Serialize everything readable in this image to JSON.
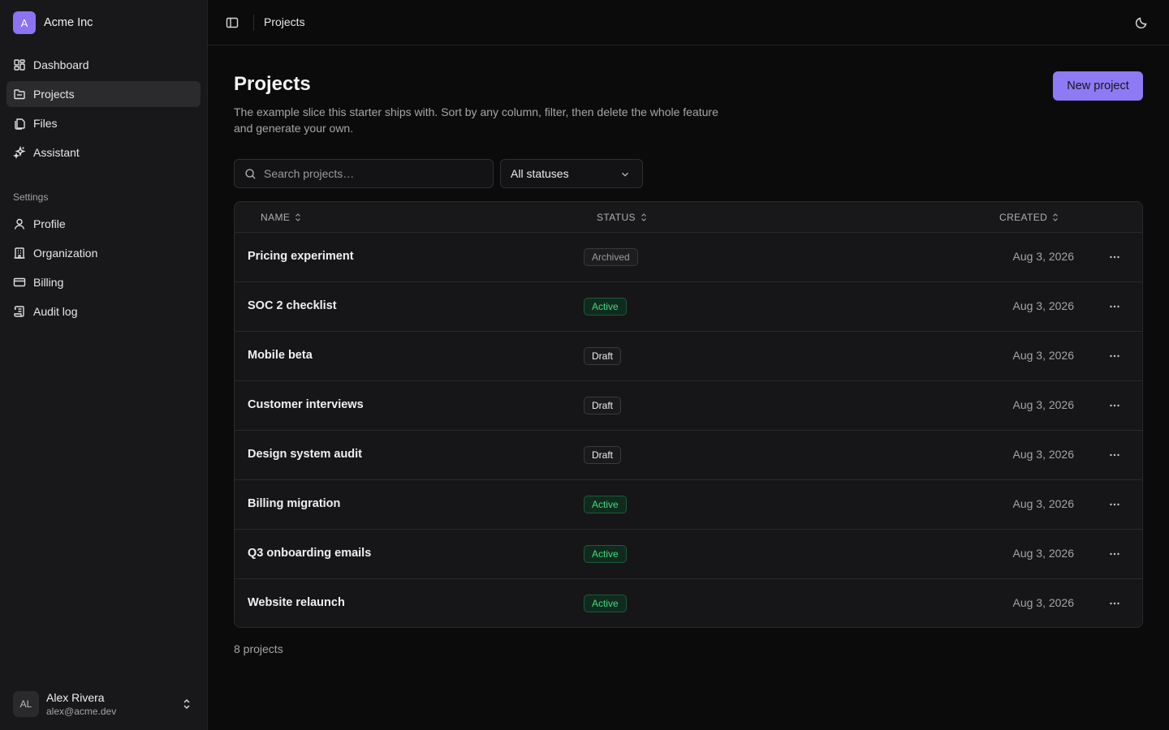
{
  "org": {
    "initial": "A",
    "name": "Acme Inc"
  },
  "nav": {
    "items": [
      {
        "label": "Dashboard",
        "icon": "dashboard-icon",
        "active": false
      },
      {
        "label": "Projects",
        "icon": "folder-icon",
        "active": true
      },
      {
        "label": "Files",
        "icon": "files-icon",
        "active": false
      },
      {
        "label": "Assistant",
        "icon": "sparkles-icon",
        "active": false
      }
    ],
    "settings_label": "Settings",
    "settings_items": [
      {
        "label": "Profile",
        "icon": "user-icon"
      },
      {
        "label": "Organization",
        "icon": "building-icon"
      },
      {
        "label": "Billing",
        "icon": "credit-card-icon"
      },
      {
        "label": "Audit log",
        "icon": "scroll-icon"
      }
    ]
  },
  "user": {
    "initials": "AL",
    "name": "Alex Rivera",
    "email": "alex@acme.dev"
  },
  "topbar": {
    "breadcrumb": "Projects"
  },
  "page": {
    "title": "Projects",
    "description": "The example slice this starter ships with. Sort by any column, filter, then delete the whole feature and generate your own.",
    "new_button": "New project"
  },
  "filters": {
    "search_placeholder": "Search projects…",
    "status_value": "All statuses"
  },
  "table": {
    "columns": [
      "NAME",
      "STATUS",
      "CREATED"
    ],
    "rows": [
      {
        "name": "Pricing experiment",
        "status": "Archived",
        "created": "Aug 3, 2026"
      },
      {
        "name": "SOC 2 checklist",
        "status": "Active",
        "created": "Aug 3, 2026"
      },
      {
        "name": "Mobile beta",
        "status": "Draft",
        "created": "Aug 3, 2026"
      },
      {
        "name": "Customer interviews",
        "status": "Draft",
        "created": "Aug 3, 2026"
      },
      {
        "name": "Design system audit",
        "status": "Draft",
        "created": "Aug 3, 2026"
      },
      {
        "name": "Billing migration",
        "status": "Active",
        "created": "Aug 3, 2026"
      },
      {
        "name": "Q3 onboarding emails",
        "status": "Active",
        "created": "Aug 3, 2026"
      },
      {
        "name": "Website relaunch",
        "status": "Active",
        "created": "Aug 3, 2026"
      }
    ]
  },
  "footer": {
    "count": "8 projects"
  },
  "colors": {
    "accent": "#8f7af6",
    "active_status": "#3ddc84"
  }
}
